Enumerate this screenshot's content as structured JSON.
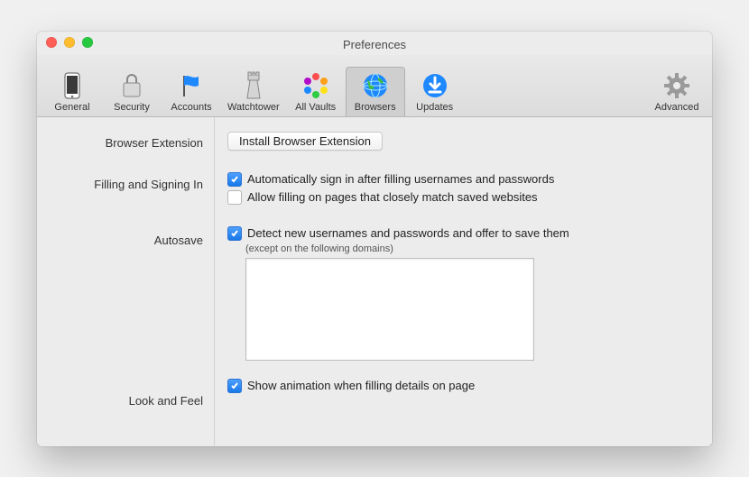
{
  "window": {
    "title": "Preferences"
  },
  "toolbar": {
    "items": [
      {
        "id": "general",
        "label": "General"
      },
      {
        "id": "security",
        "label": "Security"
      },
      {
        "id": "accounts",
        "label": "Accounts"
      },
      {
        "id": "watchtower",
        "label": "Watchtower"
      },
      {
        "id": "allvaults",
        "label": "All Vaults"
      },
      {
        "id": "browsers",
        "label": "Browsers"
      },
      {
        "id": "updates",
        "label": "Updates"
      },
      {
        "id": "advanced",
        "label": "Advanced"
      }
    ],
    "selected": "browsers"
  },
  "sections": {
    "browser_extension": {
      "label": "Browser Extension",
      "install_button": "Install Browser Extension"
    },
    "filling": {
      "label": "Filling and Signing In",
      "auto_signin": {
        "checked": true,
        "text": "Automatically sign in after filling usernames and passwords"
      },
      "allow_close_match": {
        "checked": false,
        "text": "Allow filling on pages that closely match saved websites"
      }
    },
    "autosave": {
      "label": "Autosave",
      "detect": {
        "checked": true,
        "text": "Detect new usernames and passwords and offer to save them"
      },
      "except_note": "(except on the following domains)",
      "domains_value": ""
    },
    "look": {
      "label": "Look and Feel",
      "animation": {
        "checked": true,
        "text": "Show animation when filling details on page"
      }
    }
  }
}
